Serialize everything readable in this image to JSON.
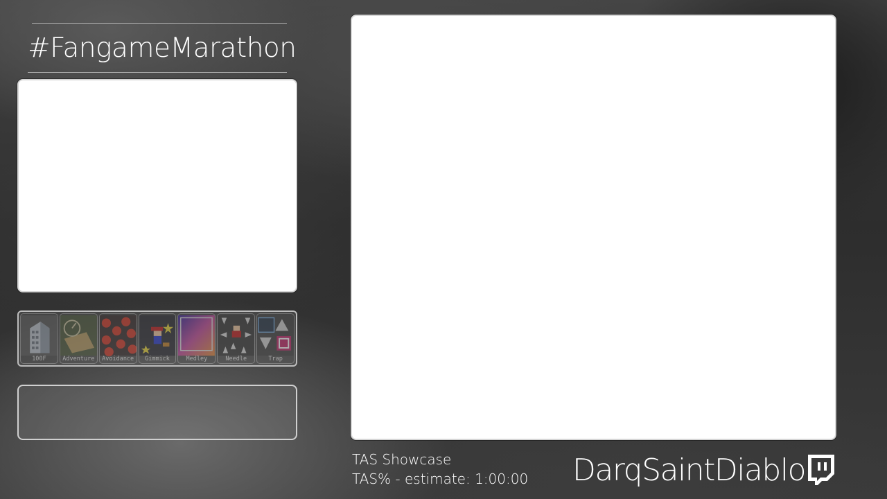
{
  "header": {
    "hashtag": "#FangameMarathon"
  },
  "categories": [
    {
      "label": "100F",
      "icon": "building-icon"
    },
    {
      "label": "Adventure",
      "icon": "map-icon"
    },
    {
      "label": "Avoidance",
      "icon": "cherries-icon"
    },
    {
      "label": "Gimmick",
      "icon": "kid-icon"
    },
    {
      "label": "Medley",
      "icon": "gradient-icon"
    },
    {
      "label": "Needle",
      "icon": "spikes-icon"
    },
    {
      "label": "Trap",
      "icon": "trap-icon"
    }
  ],
  "run": {
    "game": "TAS Showcase",
    "category_line": "TAS% - estimate: 1:00:00"
  },
  "runner": {
    "name": "DarqSaintDiablo",
    "platform_icon": "twitch-icon"
  },
  "colors": {
    "panel": "#ffffff",
    "text": "#ffffff"
  }
}
